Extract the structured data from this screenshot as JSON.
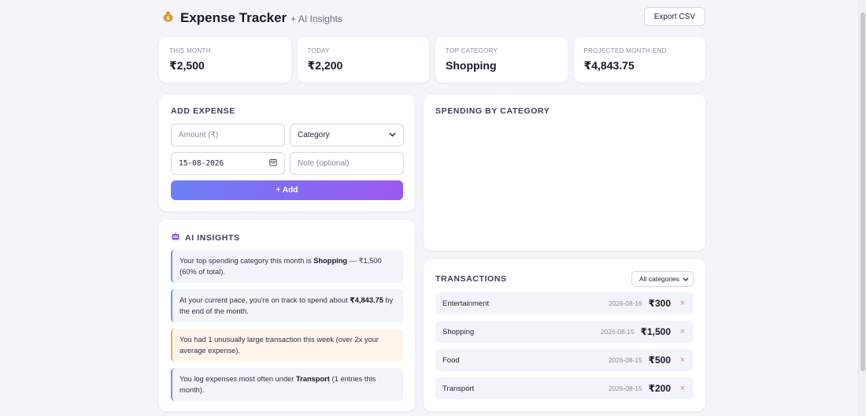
{
  "header": {
    "icon": "money-bag-icon",
    "title": "Expense Tracker",
    "subtitle": "+ AI Insights",
    "export_label": "Export CSV"
  },
  "stats": [
    {
      "label": "THIS MONTH",
      "value": "₹2,500"
    },
    {
      "label": "TODAY",
      "value": "₹2,200"
    },
    {
      "label": "TOP CATEGORY",
      "value": "Shopping"
    },
    {
      "label": "PROJECTED MONTH-END",
      "value": "₹4,843.75"
    }
  ],
  "add_expense": {
    "title": "ADD EXPENSE",
    "amount_placeholder": "Amount (₹)",
    "category_value": "Category",
    "date_value": "15-08-2026",
    "note_placeholder": "Note (optional)",
    "add_label": "+ Add"
  },
  "insights": {
    "icon": "robot-icon",
    "title": "AI INSIGHTS",
    "items": [
      {
        "pre": "Your top spending category this month is ",
        "bold": "Shopping",
        "post": " — ₹1,500 (60% of total).",
        "tone": "info"
      },
      {
        "pre": "At your current pace, you're on track to spend about ",
        "bold": "₹4,843.75",
        "post": " by the end of the month.",
        "tone": "info"
      },
      {
        "pre": "You had 1 unusually large transaction this week (over 2x your average expense).",
        "bold": "",
        "post": "",
        "tone": "warn"
      },
      {
        "pre": "You log expenses most often under ",
        "bold": "Transport",
        "post": " (1 entries this month).",
        "tone": "info"
      }
    ]
  },
  "chart": {
    "title": "SPENDING BY CATEGORY"
  },
  "transactions": {
    "title": "TRANSACTIONS",
    "filter_value": "All categories",
    "rows": [
      {
        "category": "Entertainment",
        "date": "2026-08-16",
        "amount": "₹300",
        "delete_icon": "×"
      },
      {
        "category": "Shopping",
        "date": "2026-08-15",
        "amount": "₹1,500",
        "delete_icon": "×"
      },
      {
        "category": "Food",
        "date": "2026-08-15",
        "amount": "₹500",
        "delete_icon": "×"
      },
      {
        "category": "Transport",
        "date": "2026-08-15",
        "amount": "₹200",
        "delete_icon": "×"
      }
    ]
  },
  "colors": {
    "accent_start": "#6d7ff7",
    "accent_end": "#9b58f0",
    "delete": "#e07a84",
    "warn_border": "#f3a56a"
  }
}
